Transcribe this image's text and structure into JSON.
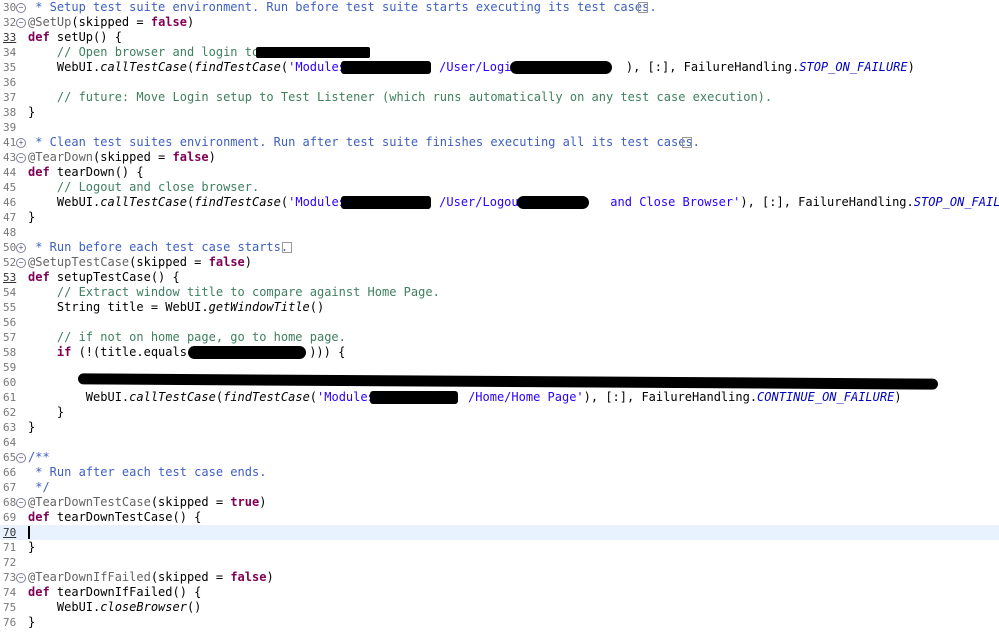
{
  "editor": {
    "lines": {
      "l30": {
        "num": "30",
        "text": " * Setup test suite environment. Run before test suite starts executing its test cases."
      },
      "l32": {
        "num": "32",
        "ann": "@SetUp",
        "rest": "(skipped = ",
        "kw": "false",
        "end": ")"
      },
      "l33": {
        "num": "33",
        "kw": "def",
        "text": " setUp() {"
      },
      "l34": {
        "num": "34",
        "cm": "    // Open browser and login to "
      },
      "l35": {
        "num": "35",
        "a": "    WebUI.",
        "fn": "callTestCase",
        "b": "(",
        "fn2": "findTestCase",
        "c": "(",
        "str1": "'Modules/",
        "str2": "/User/Login ",
        "d": "), [:], FailureHandling.",
        "const": "STOP_ON_FAILURE",
        "e": ")"
      },
      "l36": {
        "num": "36"
      },
      "l37": {
        "num": "37",
        "cm": "    // future: Move Login setup to Test Listener (which runs automatically on any test case execution)."
      },
      "l38": {
        "num": "38",
        "text": "}"
      },
      "l39": {
        "num": "39"
      },
      "l41": {
        "num": "41",
        "text": " * Clean test suites environment. Run after test suite finishes executing all its test cases."
      },
      "l43": {
        "num": "43",
        "ann": "@TearDown",
        "rest": "(skipped = ",
        "kw": "false",
        "end": ")"
      },
      "l44": {
        "num": "44",
        "kw": "def",
        "text": " tearDown() {"
      },
      "l45": {
        "num": "45",
        "cm": "    // Logout and close browser."
      },
      "l46": {
        "num": "46",
        "a": "    WebUI.",
        "fn": "callTestCase",
        "b": "(",
        "fn2": "findTestCase",
        "c": "(",
        "str1": "'Modules/",
        "str2": "/User/Logout ",
        "str3": " and Close Browser'",
        "d": "), [:], FailureHandling.",
        "const": "STOP_ON_FAILURE",
        "e": ")"
      },
      "l47": {
        "num": "47",
        "text": "}"
      },
      "l48": {
        "num": "48"
      },
      "l50": {
        "num": "50",
        "text": " * Run before each test case starts."
      },
      "l52": {
        "num": "52",
        "ann": "@SetupTestCase",
        "rest": "(skipped = ",
        "kw": "false",
        "end": ")"
      },
      "l53": {
        "num": "53",
        "kw": "def",
        "text": " setupTestCase() {"
      },
      "l54": {
        "num": "54",
        "cm": "    // Extract window title to compare against Home Page."
      },
      "l55": {
        "num": "55",
        "a": "    String title = WebUI.",
        "fn": "getWindowTitle",
        "e": "()"
      },
      "l56": {
        "num": "56"
      },
      "l57": {
        "num": "57",
        "cm": "    // if not on home page, go to home page."
      },
      "l58": {
        "num": "58",
        "a": "    ",
        "kw": "if",
        "b": " (!(title.",
        "fn": "equals",
        "c": "(",
        "e": "))) {"
      },
      "l59": {
        "num": "59"
      },
      "l60": {
        "num": "60"
      },
      "l61": {
        "num": "61",
        "a": "        WebUI.",
        "fn": "callTestCase",
        "b": "(",
        "fn2": "findTestCase",
        "c": "(",
        "str1": "'Modules/",
        "str2": "/Home/Home Page'",
        "d": "), [:], FailureHandling.",
        "const": "CONTINUE_ON_FAILURE",
        "e": ")"
      },
      "l62": {
        "num": "62",
        "text": "    }"
      },
      "l63": {
        "num": "63",
        "text": "}"
      },
      "l64": {
        "num": "64"
      },
      "l65": {
        "num": "65",
        "text": "/**"
      },
      "l66": {
        "num": "66",
        "text": " * Run after each test case ends."
      },
      "l67": {
        "num": "67",
        "text": " */"
      },
      "l68": {
        "num": "68",
        "ann": "@TearDownTestCase",
        "rest": "(skipped = ",
        "kw": "true",
        "end": ")"
      },
      "l69": {
        "num": "69",
        "kw": "def",
        "text": " tearDownTestCase() {"
      },
      "l70": {
        "num": "70"
      },
      "l71": {
        "num": "71",
        "text": "}"
      },
      "l72": {
        "num": "72"
      },
      "l73": {
        "num": "73",
        "ann": "@TearDownIfFailed",
        "rest": "(skipped = ",
        "kw": "false",
        "end": ")"
      },
      "l74": {
        "num": "74",
        "kw": "def",
        "text": " tearDownIfFailed() {"
      },
      "l75": {
        "num": "75",
        "a": "    WebUI.",
        "fn": "closeBrowser",
        "e": "()"
      },
      "l76": {
        "num": "76",
        "text": "}"
      }
    },
    "fold_collapsed_glyph": "⊕",
    "fold_expanded_glyph": "⊖"
  }
}
